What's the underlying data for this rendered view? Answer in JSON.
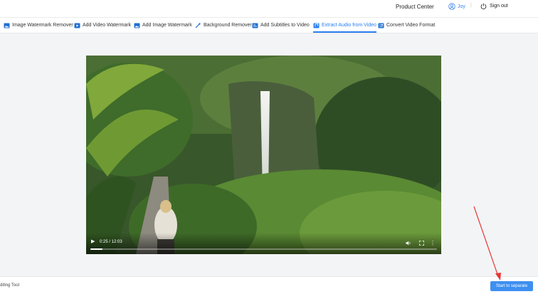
{
  "header": {
    "product_center": "Product Center",
    "user_name": "Joy",
    "separator": "|",
    "sign_out": "Sign out"
  },
  "tabs": [
    {
      "label": "Image Watermark Remover",
      "icon": "image-icon"
    },
    {
      "label": "Add Video Watermark",
      "icon": "video-icon"
    },
    {
      "label": "Add Image Watermark",
      "icon": "image-icon"
    },
    {
      "label": "Background Remover",
      "icon": "magic-wand-icon"
    },
    {
      "label": "Add Subtitles to Video",
      "icon": "subtitle-icon"
    },
    {
      "label": "Extract Audio from Video",
      "icon": "audio-extract-icon",
      "active": true
    },
    {
      "label": "Convert Video Format",
      "icon": "convert-icon"
    }
  ],
  "video": {
    "time": "0:25 / 12:03",
    "progress": 0.035
  },
  "footer": {
    "left_text": "diting Tool",
    "start_button": "Start to separate"
  },
  "colors": {
    "accent": "#2a7ff0",
    "button": "#3d8ff0",
    "annotation_arrow": "#e53935"
  }
}
